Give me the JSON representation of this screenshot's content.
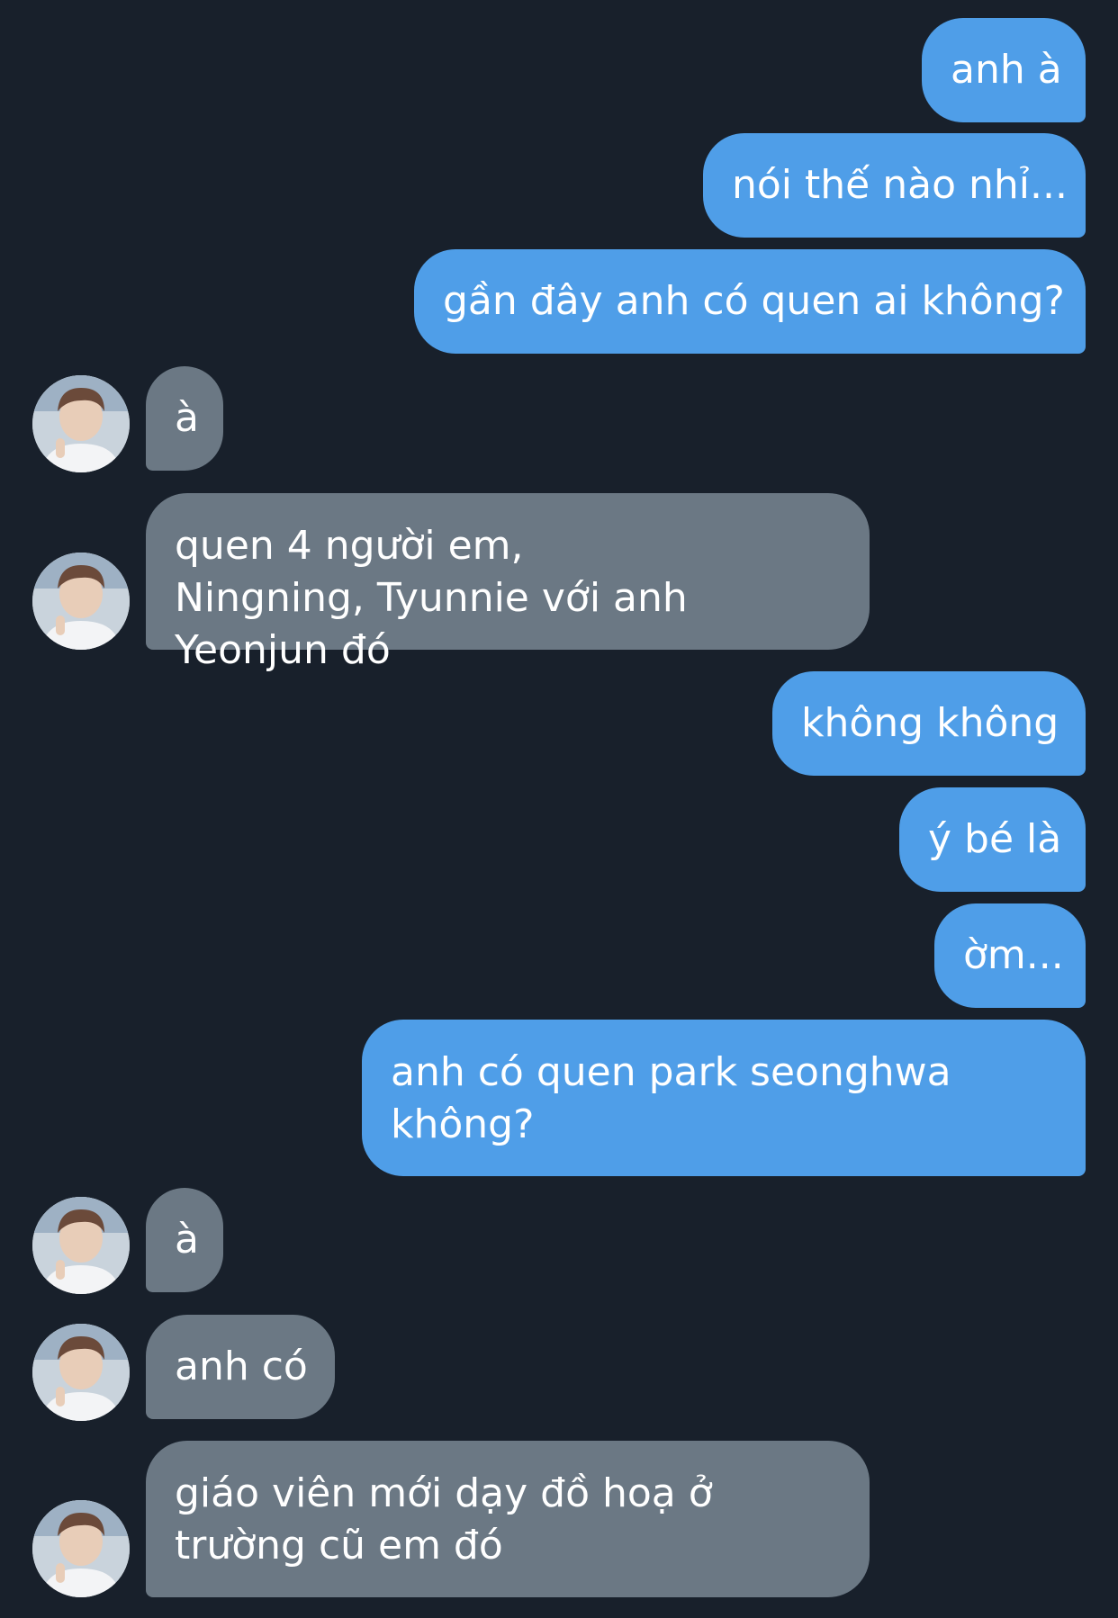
{
  "conversation": {
    "messages": [
      {
        "sender": "me",
        "text": "anh à"
      },
      {
        "sender": "me",
        "text": "nói thế nào nhỉ..."
      },
      {
        "sender": "me",
        "text": "gần đây anh có quen ai không?"
      },
      {
        "sender": "them",
        "text": "à"
      },
      {
        "sender": "them",
        "text": "quen 4 người em, Ningning, Tyunnie với anh Yeonjun đó"
      },
      {
        "sender": "me",
        "text": "không không"
      },
      {
        "sender": "me",
        "text": "ý bé là"
      },
      {
        "sender": "me",
        "text": "ờm..."
      },
      {
        "sender": "me",
        "text": "anh có quen park seonghwa không?"
      },
      {
        "sender": "them",
        "text": "à"
      },
      {
        "sender": "them",
        "text": "anh có"
      },
      {
        "sender": "them",
        "text": "giáo viên mới dạy đồ hoạ ở trường cũ em đó"
      }
    ]
  },
  "colors": {
    "background": "#18202b",
    "outgoing_bubble": "#4f9ee8",
    "incoming_bubble": "#6b7884",
    "text": "#ffffff"
  },
  "icons": {
    "avatar": "contact-avatar-icon"
  }
}
